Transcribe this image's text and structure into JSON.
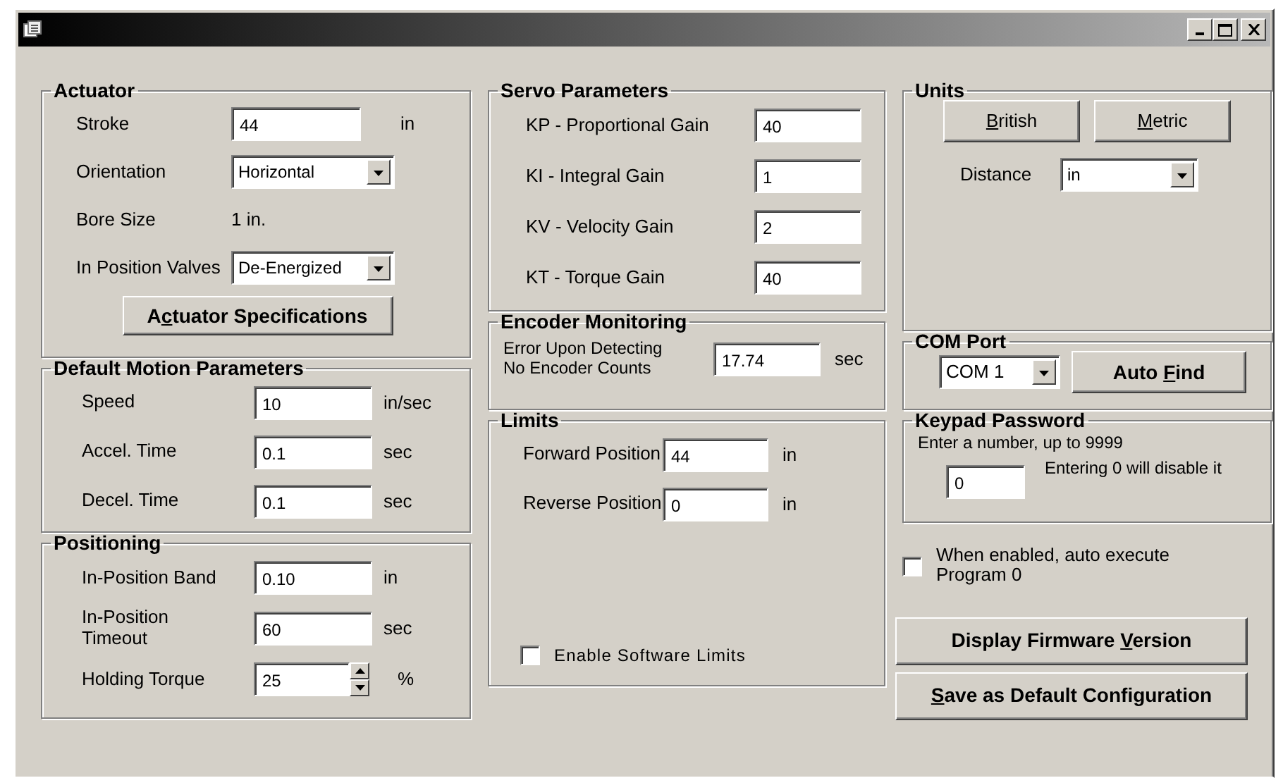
{
  "columns": [
    {
      "groups": [
        {
          "title": "Actuator",
          "rows": [
            {
              "kind": "input",
              "label": "Stroke",
              "value": "44",
              "unit": "in"
            },
            {
              "kind": "select",
              "label": "Orientation",
              "value": "Horizontal"
            },
            {
              "kind": "value",
              "label": "Bore Size",
              "value": "1 in."
            },
            {
              "kind": "select",
              "label": "In Position Valves",
              "value": "De-Energized"
            },
            {
              "kind": "button",
              "label": {
                "pre": "A",
                "key": "c",
                "post": "tuator Specifications"
              }
            }
          ]
        },
        {
          "title": "Default Motion Parameters",
          "rows": [
            {
              "kind": "input",
              "label": "Speed",
              "value": "10",
              "unit": "in/sec"
            },
            {
              "kind": "input",
              "label": "Accel. Time",
              "value": "0.1",
              "unit": "sec"
            },
            {
              "kind": "input",
              "label": "Decel. Time",
              "value": "0.1",
              "unit": "sec"
            }
          ]
        },
        {
          "title": "Positioning",
          "rows": [
            {
              "kind": "input",
              "label": "In-Position Band",
              "value": "0.10",
              "unit": "in"
            },
            {
              "kind": "input",
              "label": "In-Position Timeout",
              "value": "60",
              "unit": "sec"
            },
            {
              "kind": "spin",
              "label": "Holding Torque",
              "value": "25",
              "unit": "%"
            }
          ]
        }
      ]
    },
    {
      "groups": [
        {
          "title": "Servo Parameters",
          "rows": [
            {
              "kind": "input",
              "label": "KP - Proportional Gain",
              "value": "40"
            },
            {
              "kind": "input",
              "label": "KI - Integral Gain",
              "value": "1"
            },
            {
              "kind": "input",
              "label": "KV - Velocity Gain",
              "value": "2"
            },
            {
              "kind": "input",
              "label": "KT - Torque Gain",
              "value": "40"
            }
          ]
        },
        {
          "title": "Encoder Monitoring",
          "rows": [
            {
              "kind": "input",
              "label": "Error Upon Detecting No Encoder Counts",
              "value": "17.74",
              "unit": "sec"
            }
          ]
        },
        {
          "title": "Limits",
          "rows": [
            {
              "kind": "input",
              "label": "Forward Position",
              "value": "44",
              "unit": "in"
            },
            {
              "kind": "input",
              "label": "Reverse Position",
              "value": "0",
              "unit": "in"
            },
            {
              "kind": "checkbox",
              "label": "Enable Software Limits",
              "checked": false
            }
          ]
        }
      ]
    },
    {
      "groups": [
        {
          "title": "Units",
          "rows": [
            {
              "kind": "buttons",
              "buttons": [
                {
                  "label": {
                    "key": "B",
                    "post": "ritish"
                  }
                },
                {
                  "label": {
                    "key": "M",
                    "post": "etric"
                  }
                }
              ]
            },
            {
              "kind": "select",
              "label": "Distance",
              "value": "in"
            }
          ]
        },
        {
          "title": "COM Port",
          "rows": [
            {
              "kind": "select-button",
              "value": "COM 1",
              "button": {
                "label": {
                  "pre": "Auto ",
                  "key": "F",
                  "post": "ind"
                }
              }
            }
          ]
        },
        {
          "title": "Keypad Password",
          "rows": [
            {
              "kind": "note",
              "text": "Enter a number, up to 9999"
            },
            {
              "kind": "input-note",
              "value": "0",
              "note": "Entering 0 will disable it"
            }
          ]
        }
      ],
      "items": [
        {
          "kind": "checkbox",
          "label": "When enabled, auto execute Program 0",
          "checked": false
        },
        {
          "kind": "button",
          "label": {
            "pre": "Display Firmware ",
            "key": "V",
            "post": "ersion"
          }
        },
        {
          "kind": "button",
          "label": {
            "key": "S",
            "post": "ave as Default Configuration"
          }
        }
      ]
    }
  ]
}
